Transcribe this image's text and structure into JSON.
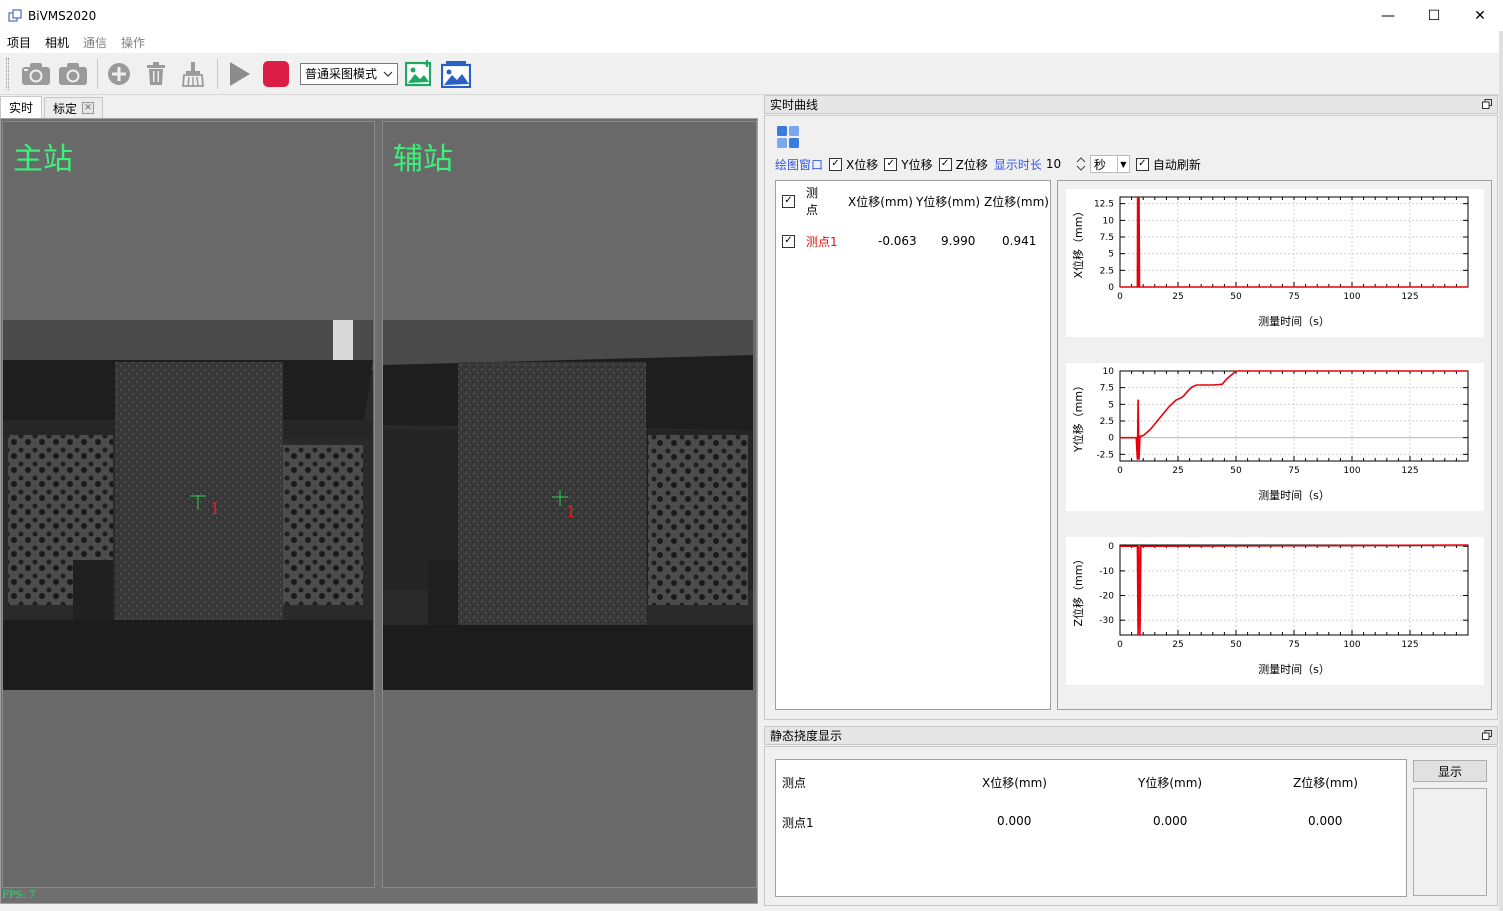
{
  "window": {
    "title": "BiVMS2020",
    "minimize": "—",
    "maximize": "☐",
    "close": "✕"
  },
  "menu": [
    {
      "label": "项目",
      "enabled": true
    },
    {
      "label": "相机",
      "enabled": true
    },
    {
      "label": "通信",
      "enabled": false
    },
    {
      "label": "操作",
      "enabled": false
    }
  ],
  "toolbar": {
    "mode_select": "普通采图模式"
  },
  "tabs": [
    {
      "label": "实时",
      "active": true,
      "closable": false
    },
    {
      "label": "标定",
      "active": false,
      "closable": true
    }
  ],
  "cameras": {
    "main_label": "主站",
    "aux_label": "辅站",
    "marker_label": "1",
    "fps": "FPS: 7"
  },
  "realtime_panel": {
    "title": "实时曲线",
    "plot_window_label": "绘图窗口",
    "x_check": "X位移",
    "y_check": "Y位移",
    "z_check": "Z位移",
    "duration_label": "显示时长",
    "duration_value": "10",
    "unit_value": "秒",
    "auto_refresh": "自动刷新"
  },
  "point_table": {
    "headers": [
      "测点",
      "X位移(mm)",
      "Y位移(mm)",
      "Z位移(mm)"
    ],
    "rows": [
      {
        "name": "测点1",
        "x": "-0.063",
        "y": "9.990",
        "z": "0.941"
      }
    ]
  },
  "chart_data": [
    {
      "type": "line",
      "ylabel": "X位移（mm）",
      "xlabel": "测量时间（s）",
      "xlim": [
        0,
        150
      ],
      "ylim": [
        0,
        13.5
      ],
      "xticks": [
        0,
        25,
        50,
        75,
        100,
        125
      ],
      "yticks": [
        0,
        2.5,
        5,
        7.5,
        10,
        12.5
      ],
      "grid": true,
      "series": [
        {
          "color": "#e8000a",
          "x": [
            0,
            7.5,
            7.6,
            8.0,
            8.2,
            8.4,
            150
          ],
          "y": [
            0,
            0,
            13.5,
            0,
            13.5,
            0,
            0
          ]
        }
      ]
    },
    {
      "type": "line",
      "ylabel": "Y位移（mm）",
      "xlabel": "测量时间（s）",
      "xlim": [
        0,
        150
      ],
      "ylim": [
        -3.5,
        10
      ],
      "xticks": [
        0,
        25,
        50,
        75,
        100,
        125
      ],
      "yticks": [
        -2.5,
        0,
        2.5,
        5,
        7.5,
        10
      ],
      "grid": true,
      "series": [
        {
          "color": "#e8000a",
          "x": [
            0,
            7,
            7.5,
            7.8,
            8.2,
            8.6,
            10,
            13,
            17,
            21,
            24,
            27,
            29,
            31,
            33,
            36,
            38,
            40,
            44,
            46,
            50,
            150
          ],
          "y": [
            0,
            0,
            -3.3,
            5.7,
            -3.3,
            0.2,
            0.3,
            1.2,
            2.9,
            4.6,
            5.6,
            6.1,
            6.9,
            7.6,
            7.9,
            7.9,
            7.9,
            7.9,
            8.0,
            8.8,
            10,
            10
          ]
        }
      ]
    },
    {
      "type": "line",
      "ylabel": "Z位移（mm）",
      "xlabel": "测量时间（s）",
      "xlim": [
        0,
        150
      ],
      "ylim": [
        -36,
        0.5
      ],
      "xticks": [
        0,
        25,
        50,
        75,
        100,
        125
      ],
      "yticks": [
        0,
        -10,
        -20,
        -30
      ],
      "grid": true,
      "series": [
        {
          "color": "#e8000a",
          "x": [
            0,
            7.5,
            7.8,
            8.2,
            8.6,
            9.0,
            150
          ],
          "y": [
            0,
            0,
            -36,
            0,
            -36,
            0,
            0.5
          ]
        }
      ]
    }
  ],
  "static_panel": {
    "title": "静态挠度显示",
    "headers": [
      "测点",
      "X位移(mm)",
      "Y位移(mm)",
      "Z位移(mm)"
    ],
    "rows": [
      {
        "name": "测点1",
        "x": "0.000",
        "y": "0.000",
        "z": "0.000"
      }
    ],
    "show_button": "显示"
  }
}
